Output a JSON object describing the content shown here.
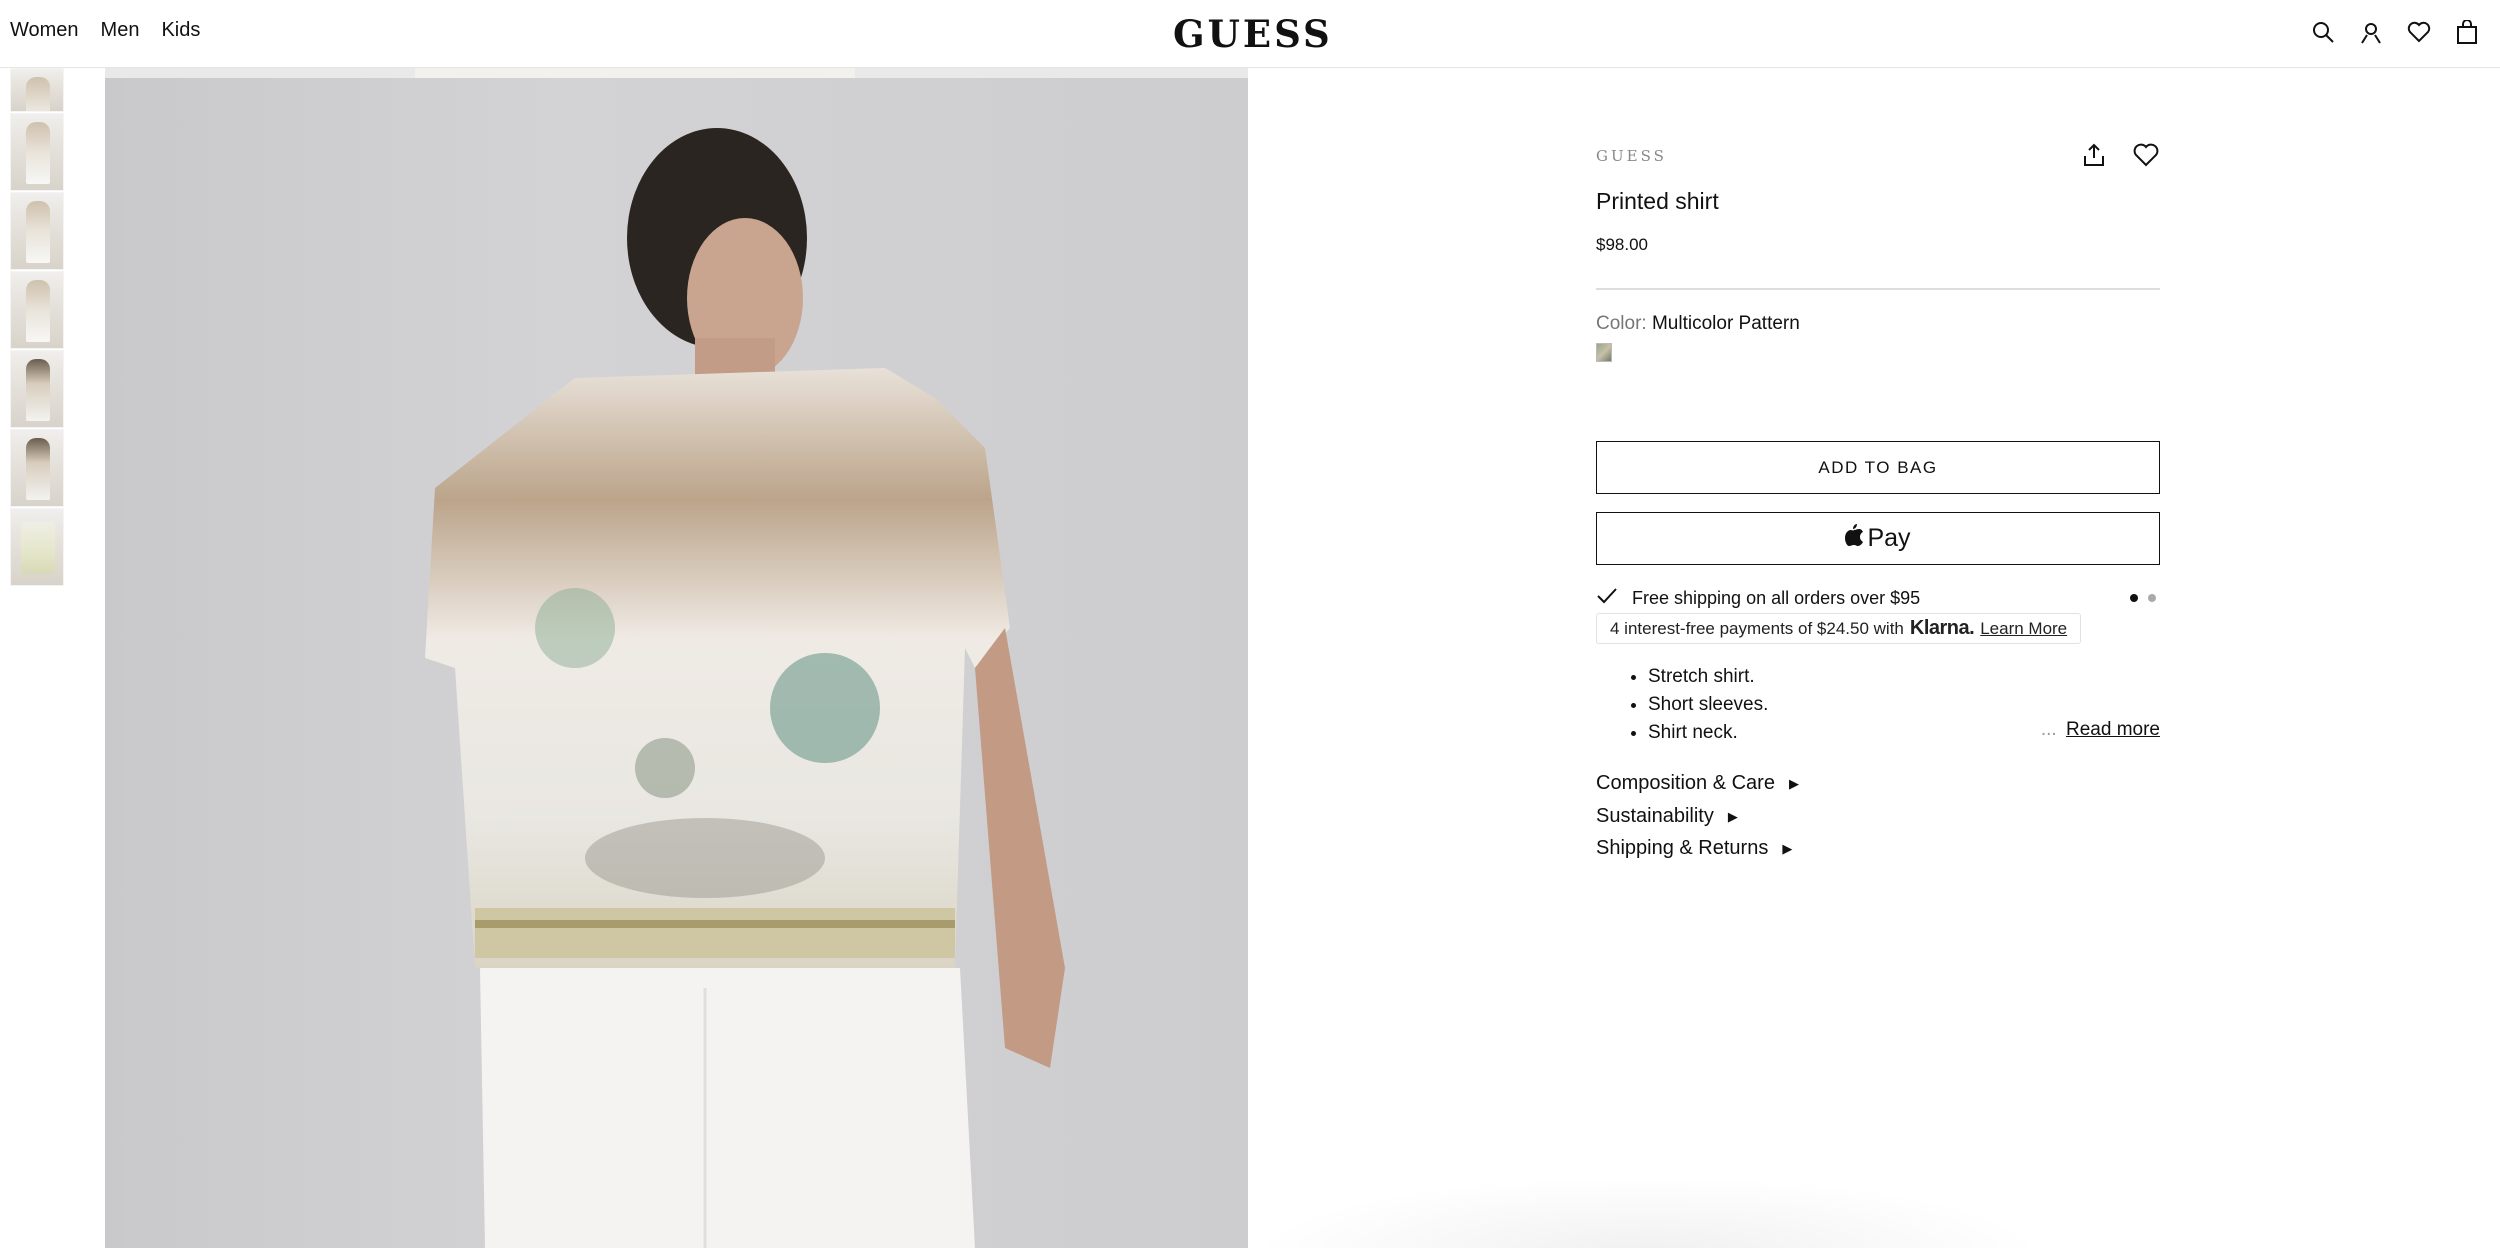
{
  "nav": {
    "items": [
      "Women",
      "Men",
      "Kids"
    ]
  },
  "logo": "GUESS",
  "header_icons": [
    "search-icon",
    "account-icon",
    "wishlist-icon",
    "bag-icon"
  ],
  "product": {
    "brand": "GUESS",
    "title": "Printed shirt",
    "price": "$98.00",
    "color_label": "Color:",
    "color_value": "Multicolor Pattern",
    "add_to_bag": "ADD TO BAG",
    "apple_pay": "Pay",
    "shipping": "Free shipping on all orders over $95",
    "klarna": {
      "prefix": "4 interest-free payments of $24.50 with",
      "brand": "Klarna.",
      "link": "Learn More"
    },
    "bullets": [
      "Stretch shirt.",
      "Short sleeves.",
      "Shirt neck."
    ],
    "read_more_ellipsis": "...",
    "read_more": "Read more",
    "accordions": [
      "Composition & Care",
      "Sustainability",
      "Shipping & Returns"
    ]
  },
  "colors": {
    "text": "#111111",
    "muted": "#777777",
    "image_bg": "#cfcfd1"
  }
}
